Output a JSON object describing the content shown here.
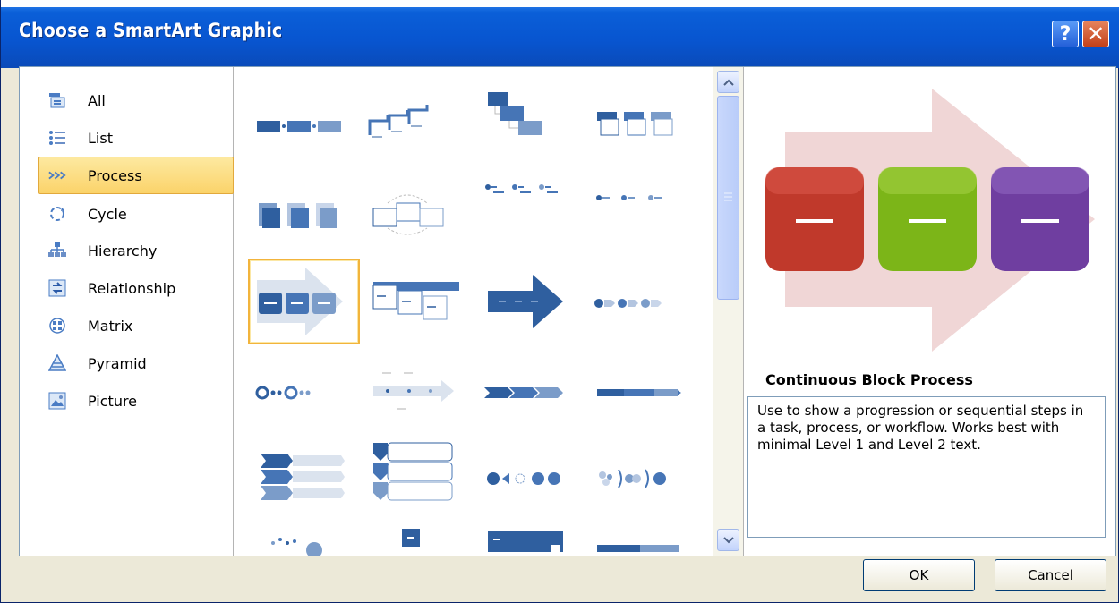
{
  "window": {
    "title": "Choose a SmartArt Graphic",
    "help_label": "?",
    "close_label": "✕"
  },
  "categories": [
    {
      "label": "All",
      "icon": "all-icon",
      "selected": false
    },
    {
      "label": "List",
      "icon": "list-icon",
      "selected": false
    },
    {
      "label": "Process",
      "icon": "process-icon",
      "selected": true
    },
    {
      "label": "Cycle",
      "icon": "cycle-icon",
      "selected": false
    },
    {
      "label": "Hierarchy",
      "icon": "hierarchy-icon",
      "selected": false
    },
    {
      "label": "Relationship",
      "icon": "relationship-icon",
      "selected": false
    },
    {
      "label": "Matrix",
      "icon": "matrix-icon",
      "selected": false
    },
    {
      "label": "Pyramid",
      "icon": "pyramid-icon",
      "selected": false
    },
    {
      "label": "Picture",
      "icon": "picture-icon",
      "selected": false
    }
  ],
  "preview": {
    "title": "Continuous Block Process",
    "description": "Use to show a progression or sequential steps in a task, process, or workflow. Works best with minimal Level 1 and Level 2 text.",
    "block_colors": [
      "#c0392b",
      "#7cb518",
      "#6f3ea0"
    ],
    "arrow_color": "#f0d6d6"
  },
  "buttons": {
    "ok": "OK",
    "cancel": "Cancel"
  },
  "colors": {
    "accent_blue": "#3a6fb5",
    "selection": "#fbd36a"
  }
}
